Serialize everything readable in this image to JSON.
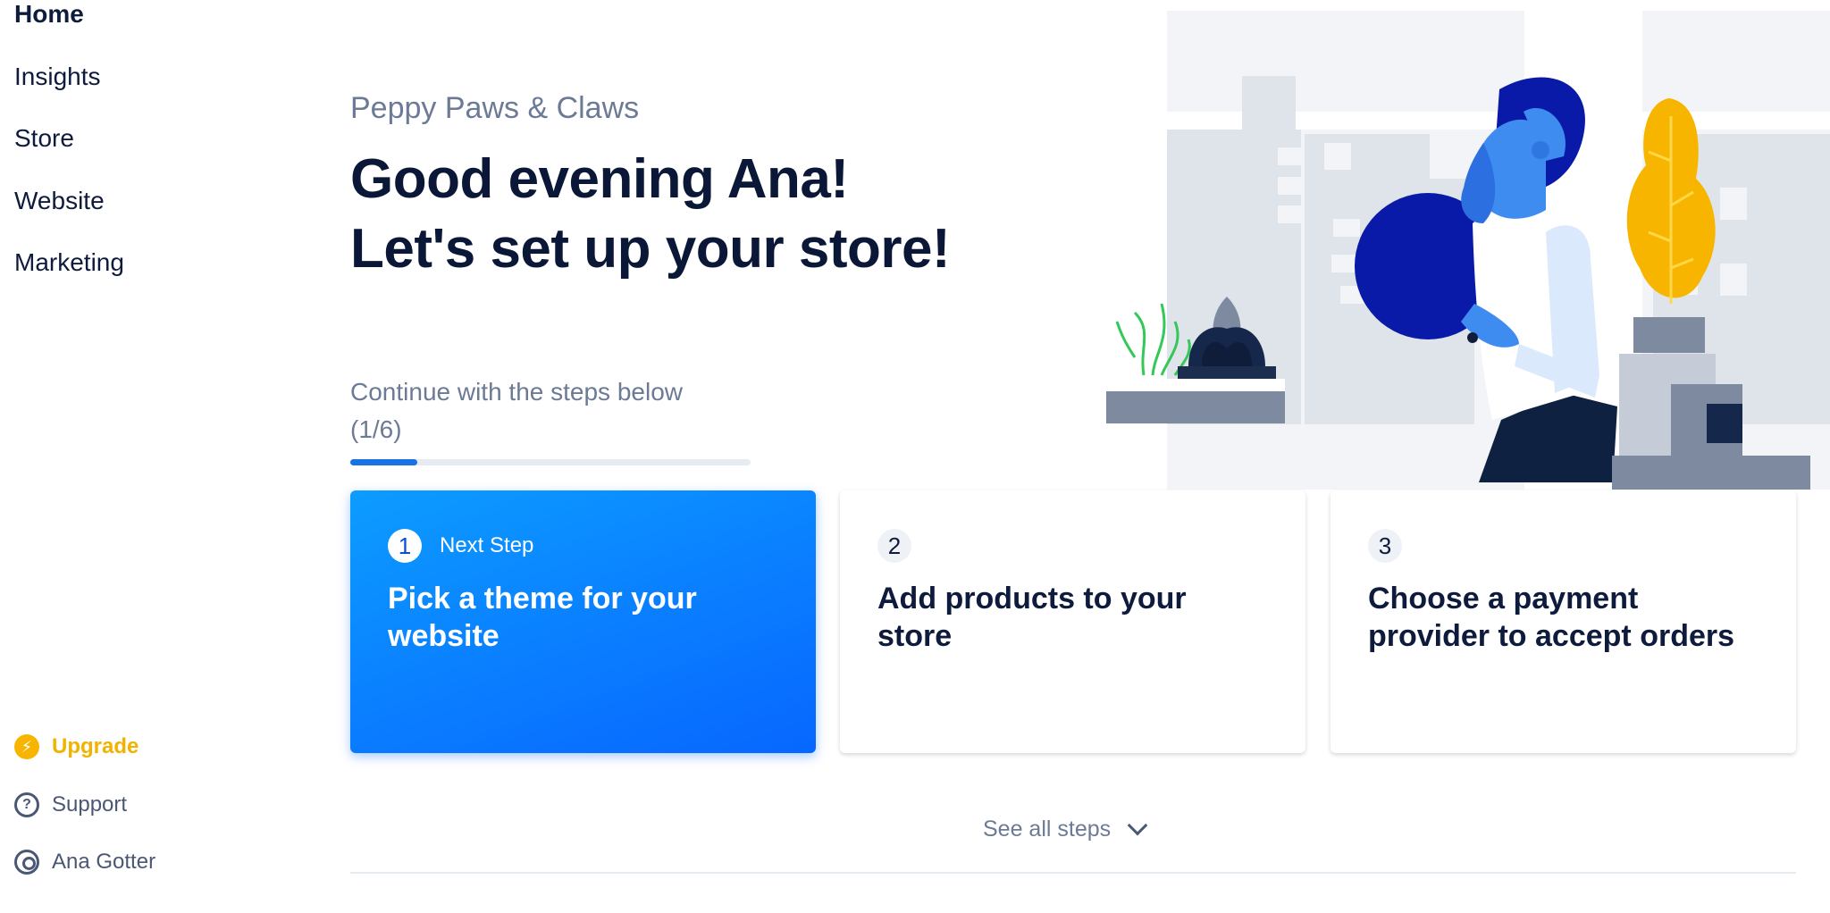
{
  "sidebar": {
    "nav": [
      {
        "label": "Home",
        "active": true
      },
      {
        "label": "Insights",
        "active": false
      },
      {
        "label": "Store",
        "active": false
      },
      {
        "label": "Website",
        "active": false
      },
      {
        "label": "Marketing",
        "active": false
      }
    ],
    "bottom": {
      "upgrade": {
        "label": "Upgrade",
        "icon": "bolt-icon"
      },
      "support": {
        "label": "Support",
        "icon": "help-icon"
      },
      "account": {
        "label": "Ana Gotter",
        "icon": "user-icon"
      }
    }
  },
  "header": {
    "store_name": "Peppy Paws & Claws",
    "greeting_line1": "Good evening Ana!",
    "greeting_line2": "Let's set up your store!"
  },
  "progress": {
    "label_line1": "Continue with the steps below",
    "label_line2": "(1/6)",
    "completed": 1,
    "total": 6
  },
  "steps": [
    {
      "number": "1",
      "tag": "Next Step",
      "title": "Pick a theme for your website"
    },
    {
      "number": "2",
      "title": "Add products to your store"
    },
    {
      "number": "3",
      "title": "Choose a payment provider to accept orders"
    }
  ],
  "see_all": {
    "label": "See all steps",
    "icon": "chevron-down-icon"
  },
  "colors": {
    "accent": "#0a7bff",
    "upgrade": "#f7b500",
    "text_dark": "#0e1b3d",
    "text_muted": "#6c7a96"
  }
}
